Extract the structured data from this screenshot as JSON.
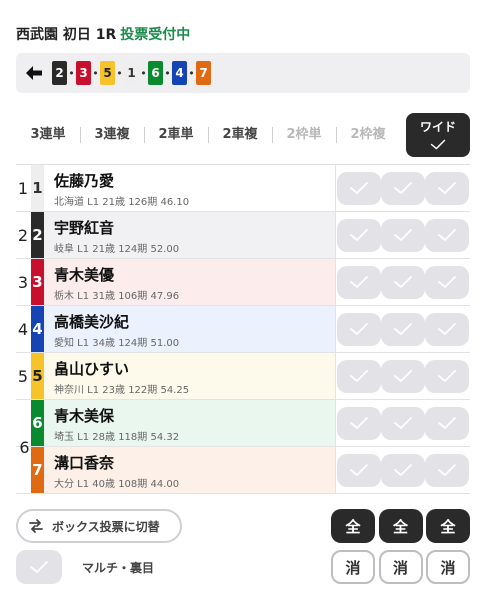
{
  "header": {
    "race": "西武園 初日 1R",
    "status": "投票受付中"
  },
  "order": [
    {
      "num": "2",
      "bg": "#2a2a2a",
      "fg": "#ffffff"
    },
    {
      "num": "3",
      "bg": "#c8102e",
      "fg": "#ffffff"
    },
    {
      "num": "5",
      "bg": "#f6c42a",
      "fg": "#222222"
    },
    {
      "num": "1",
      "bg": "#eeeeee",
      "fg": "#333333"
    },
    {
      "num": "6",
      "bg": "#0a8a2e",
      "fg": "#ffffff"
    },
    {
      "num": "4",
      "bg": "#1544b3",
      "fg": "#ffffff"
    },
    {
      "num": "7",
      "bg": "#e06a12",
      "fg": "#ffffff"
    }
  ],
  "tabs": [
    {
      "label": "3連単",
      "state": "normal"
    },
    {
      "label": "3連複",
      "state": "normal"
    },
    {
      "label": "2車単",
      "state": "normal"
    },
    {
      "label": "2車複",
      "state": "normal"
    },
    {
      "label": "2枠単",
      "state": "disabled"
    },
    {
      "label": "2枠複",
      "state": "disabled"
    },
    {
      "label": "ワイド",
      "state": "active"
    }
  ],
  "entries": [
    {
      "frame": "1",
      "num": "1",
      "name": "佐藤乃愛",
      "meta": "北海道 L1 21歳 126期 46.10",
      "num_bg": "#eeeeee",
      "num_fg": "#333333",
      "row_bg": "#ffffff"
    },
    {
      "frame": "2",
      "num": "2",
      "name": "宇野紅音",
      "meta": "岐阜 L1 21歳 124期 52.00",
      "num_bg": "#2a2a2a",
      "num_fg": "#ffffff",
      "row_bg": "#f1f1f3"
    },
    {
      "frame": "3",
      "num": "3",
      "name": "青木美優",
      "meta": "栃木 L1 31歳 106期 47.96",
      "num_bg": "#c8102e",
      "num_fg": "#ffffff",
      "row_bg": "#fdecec"
    },
    {
      "frame": "4",
      "num": "4",
      "name": "高橋美沙紀",
      "meta": "愛知 L1 34歳 124期 51.00",
      "num_bg": "#1544b3",
      "num_fg": "#ffffff",
      "row_bg": "#ebf2fd"
    },
    {
      "frame": "5",
      "num": "5",
      "name": "畠山ひすい",
      "meta": "神奈川 L1 23歳 122期 54.25",
      "num_bg": "#f6c42a",
      "num_fg": "#222222",
      "row_bg": "#fefaeb"
    },
    {
      "frame": "6",
      "num": "6",
      "name": "青木美保",
      "meta": "埼玉 L1 28歳 118期 54.32",
      "num_bg": "#0a8a2e",
      "num_fg": "#ffffff",
      "row_bg": "#eaf7ee"
    },
    {
      "frame": "",
      "num": "7",
      "name": "溝口香奈",
      "meta": "大分 L1 40歳 108期 44.00",
      "num_bg": "#e06a12",
      "num_fg": "#ffffff",
      "row_bg": "#fdf0e8"
    }
  ],
  "controls": {
    "box_label": "ボックス投票に切替",
    "multi_label": "マルチ・裏目",
    "all_label": "全",
    "clear_label": "消"
  }
}
